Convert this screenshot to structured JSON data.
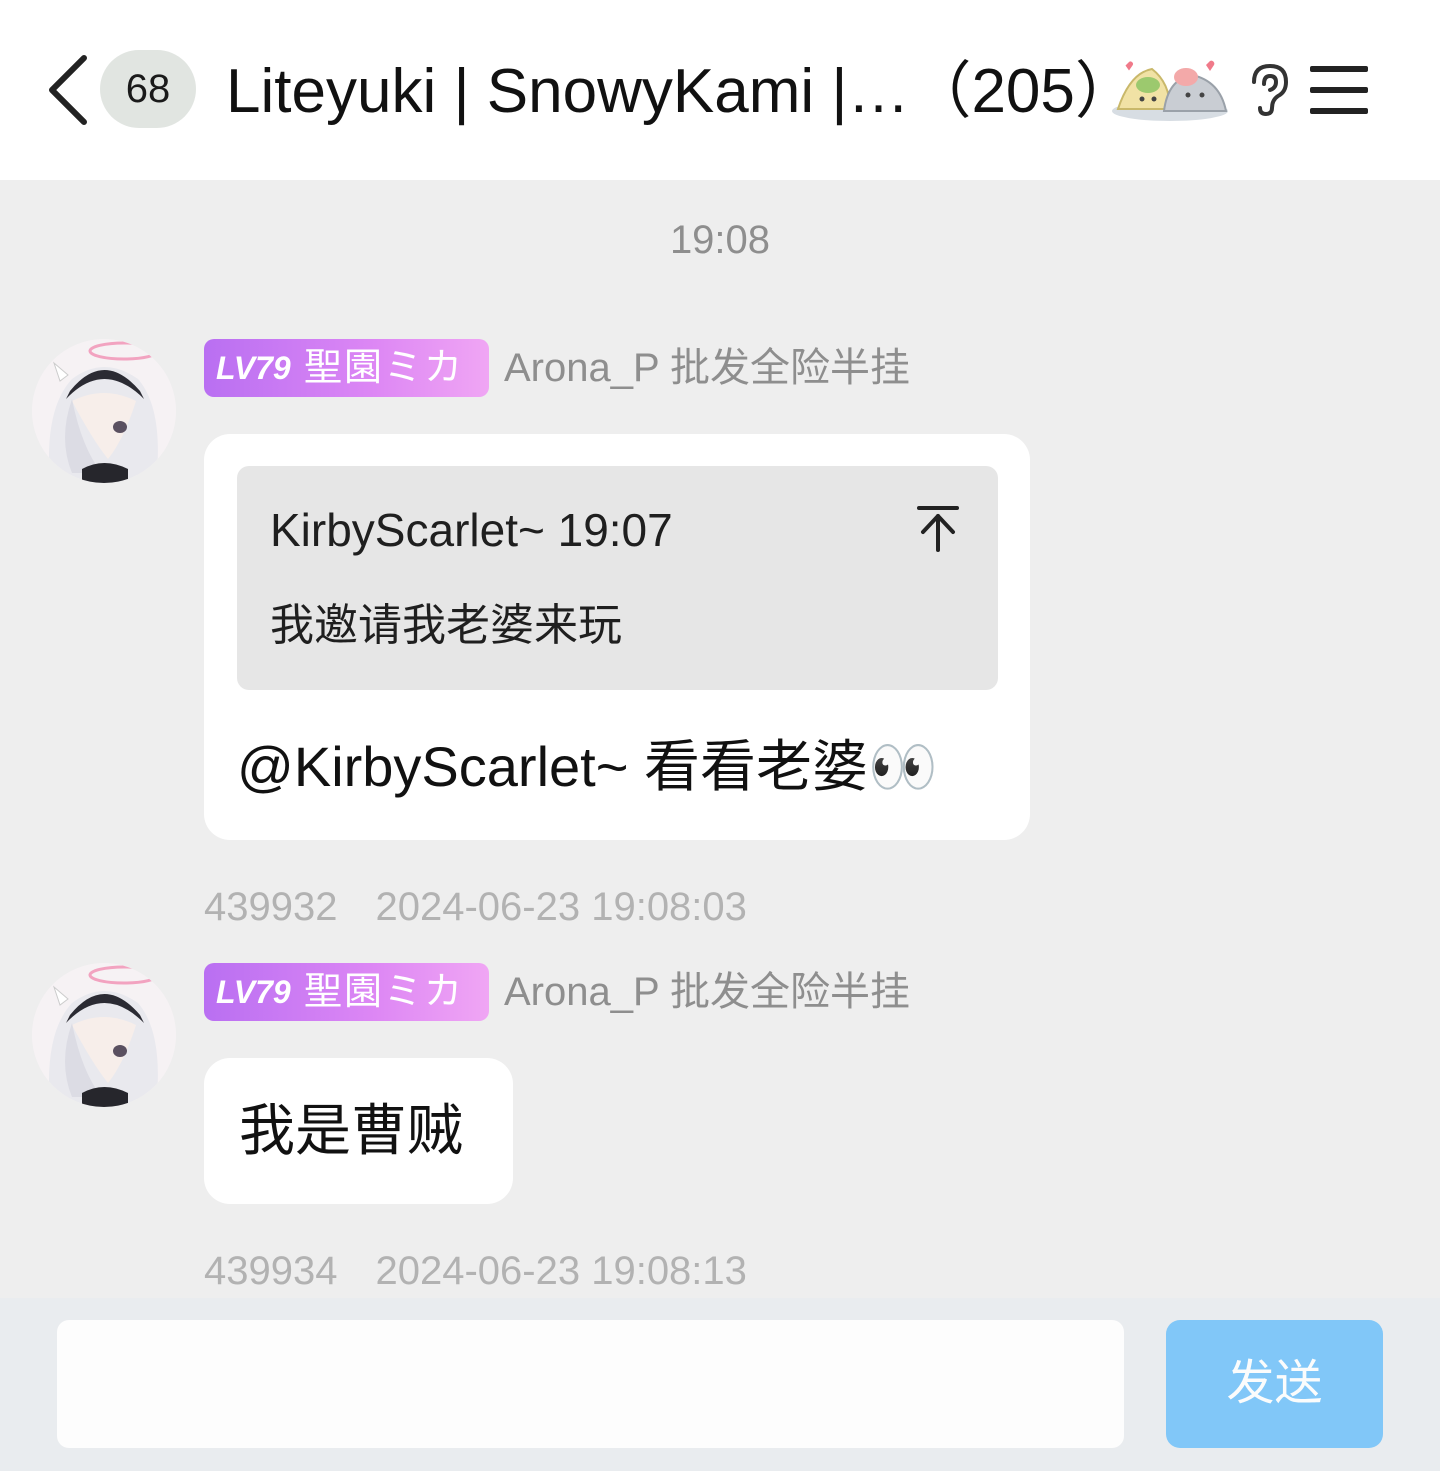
{
  "header": {
    "unread_count": "68",
    "title": "Liteyuki | SnowyKami |…（205）"
  },
  "time_divider": "19:08",
  "messages": [
    {
      "level_lv": "LV79",
      "level_title": "聖園ミカ",
      "sender": "Arona_P 批发全险半挂",
      "quote": {
        "author_time": "KirbyScarlet~ 19:07",
        "text": "我邀请我老婆来玩"
      },
      "text": "@KirbyScarlet~ 看看老婆👀",
      "msg_id": "439932",
      "timestamp": "2024-06-23 19:08:03"
    },
    {
      "level_lv": "LV79",
      "level_title": "聖園ミカ",
      "sender": "Arona_P 批发全险半挂",
      "text": "我是曹贼",
      "msg_id": "439934",
      "timestamp": "2024-06-23 19:08:13"
    }
  ],
  "input": {
    "value": "",
    "send_label": "发送"
  },
  "colors": {
    "accent": "#6fc1fa",
    "level_badge": "#c77af3",
    "background": "#eeeeee"
  }
}
